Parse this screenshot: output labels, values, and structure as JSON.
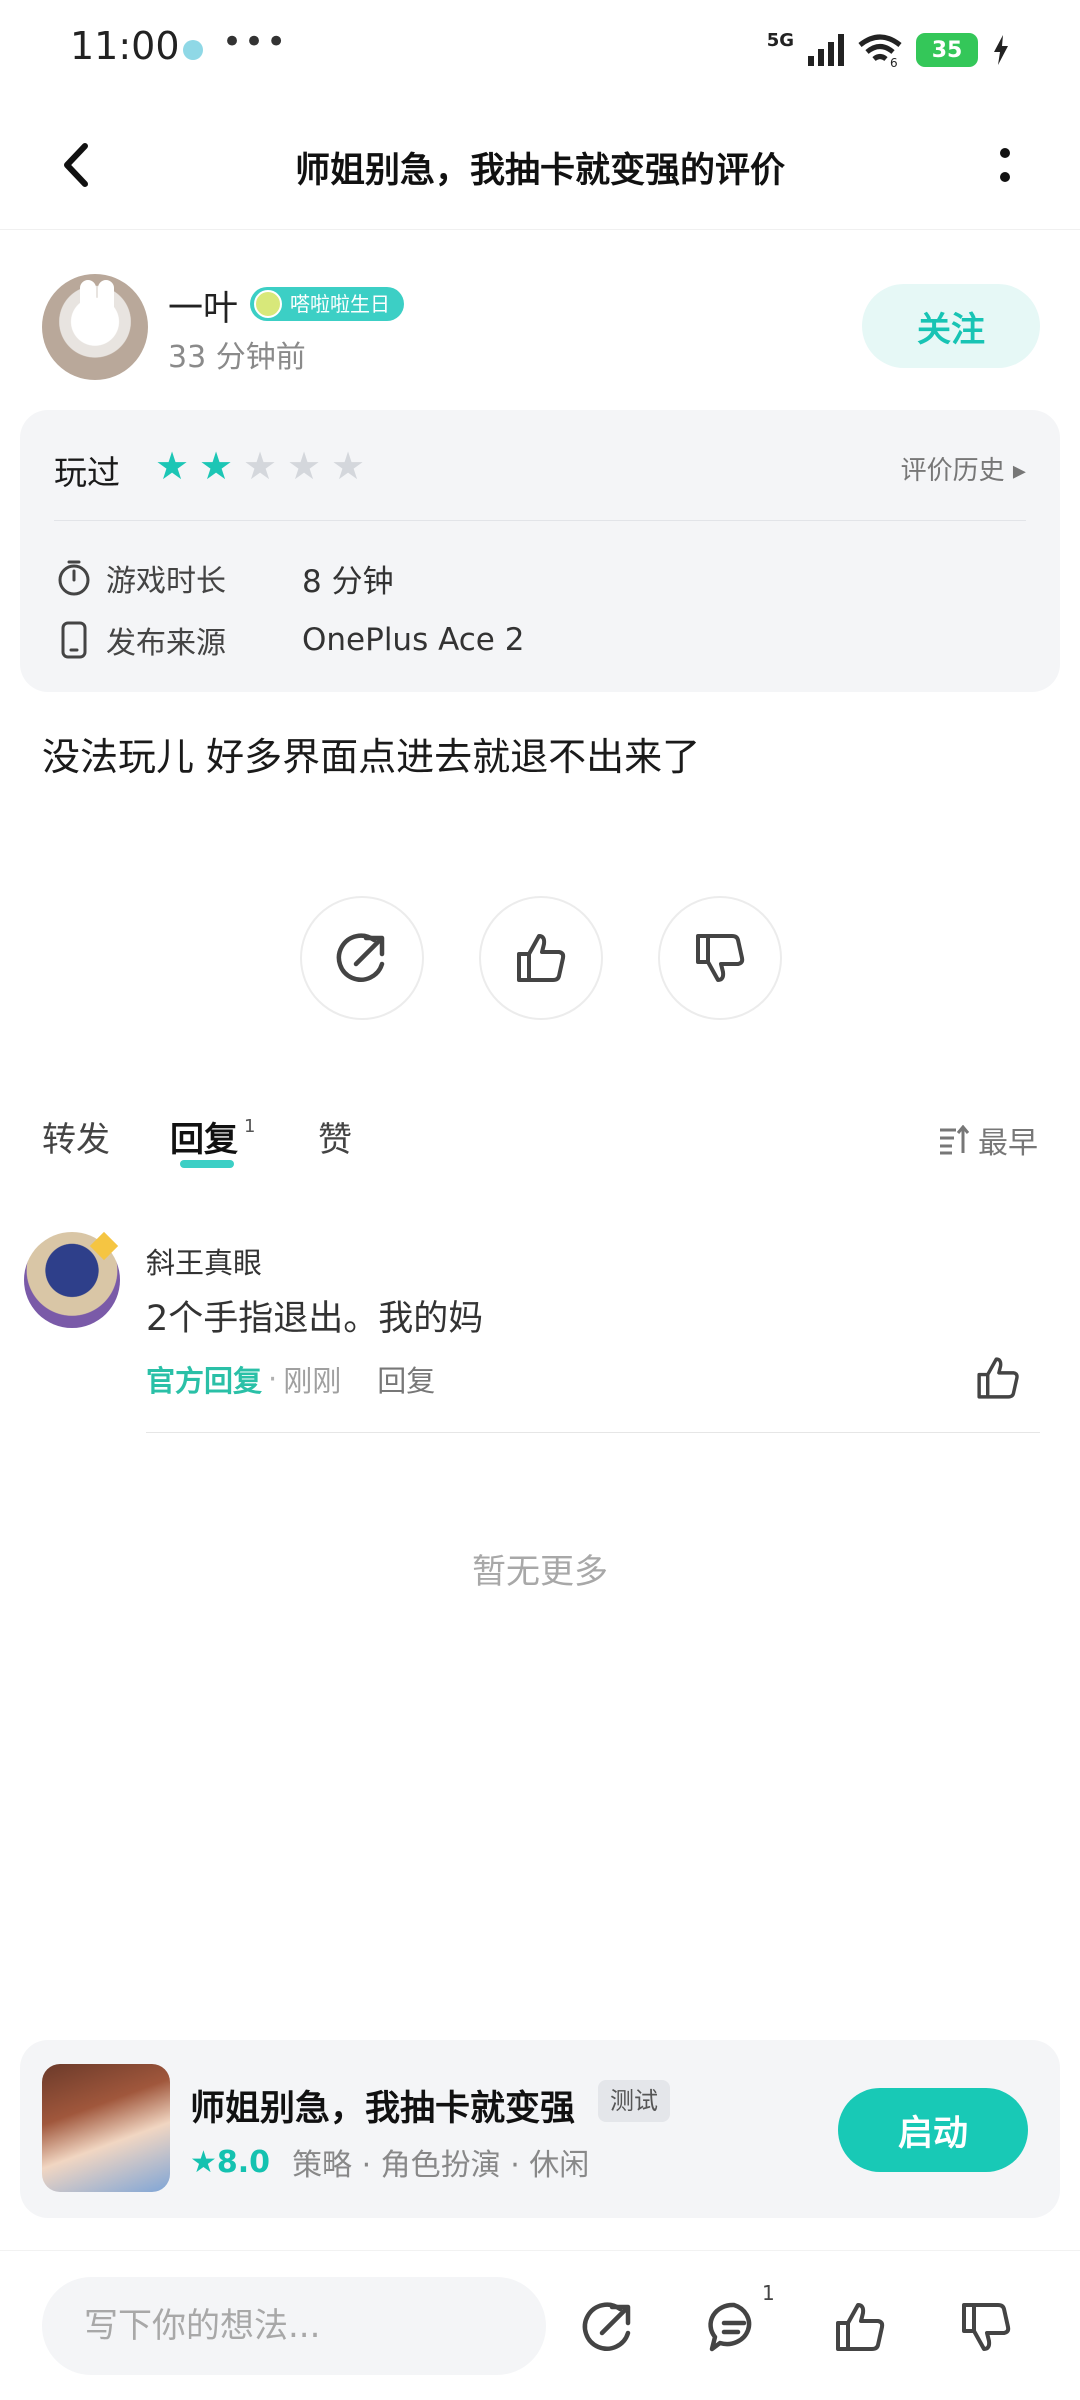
{
  "status_bar": {
    "time": "11:00",
    "more": "•••",
    "network": "5G",
    "wifi_label": "6",
    "battery": "35"
  },
  "header": {
    "title": "师姐别急，我抽卡就变强的评价"
  },
  "user": {
    "name": "一叶",
    "badge": "嗒啦啦生日",
    "time_ago": "33 分钟前",
    "follow_label": "关注"
  },
  "review_info": {
    "played_label": "玩过",
    "rating": 2,
    "max_rating": 5,
    "history_label": "评价历史 ▸",
    "rows": [
      {
        "icon": "timer-icon",
        "label": "游戏时长",
        "value": "8 分钟"
      },
      {
        "icon": "phone-icon",
        "label": "发布来源",
        "value": "OnePlus Ace 2"
      }
    ]
  },
  "review": {
    "text": "没法玩儿 好多界面点进去就退不出来了"
  },
  "tabs": {
    "items": [
      {
        "label": "转发",
        "count": ""
      },
      {
        "label": "回复",
        "count": "1"
      },
      {
        "label": "赞",
        "count": ""
      }
    ],
    "active_index": 1,
    "sort_label": "最早"
  },
  "comments": [
    {
      "author": "斜王真眼",
      "text": "2个手指退出。我的妈",
      "official_label": "官方回复",
      "separator": "·",
      "time_ago": "刚刚",
      "reply_label": "回复"
    }
  ],
  "no_more_label": "暂无更多",
  "game_card": {
    "title": "师姐别急，我抽卡就变强",
    "tag": "测试",
    "score": "8.0",
    "genres": "策略 · 角色扮演 · 休闲",
    "launch_label": "启动"
  },
  "bottom_bar": {
    "input_placeholder": "写下你的想法...",
    "comment_count": "1"
  },
  "colors": {
    "accent": "#18c9b6",
    "star_on": "#1cc6b5",
    "star_off": "#d4d7dc",
    "official": "#2ac0a7"
  }
}
